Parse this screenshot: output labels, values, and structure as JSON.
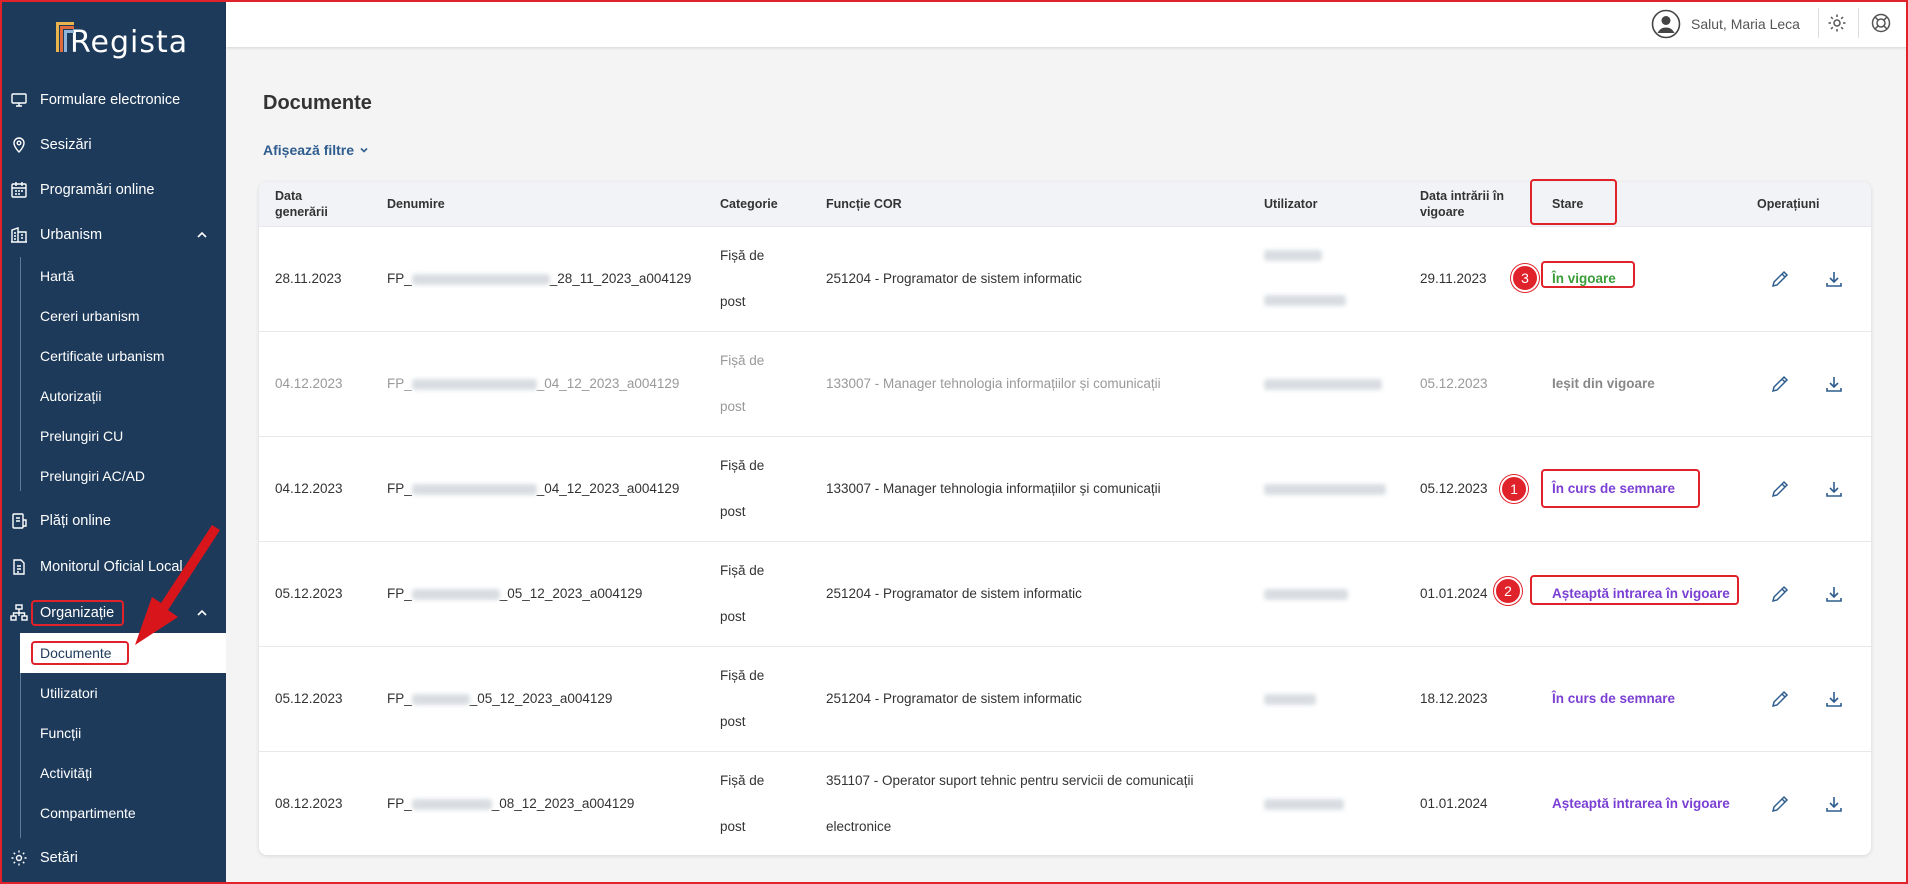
{
  "app": {
    "logo_text": "Regista"
  },
  "sidebar": {
    "items": [
      {
        "label": "Formulare electronice",
        "icon": "monitor-icon"
      },
      {
        "label": "Sesizări",
        "icon": "map-pin-icon"
      },
      {
        "label": "Programări online",
        "icon": "calendar-icon"
      },
      {
        "label": "Urbanism",
        "icon": "building-icon"
      },
      {
        "label": "Plăți online",
        "icon": "payment-icon"
      },
      {
        "label": "Monitorul Oficial Local",
        "icon": "gazette-icon"
      },
      {
        "label": "Organizație",
        "icon": "org-chart-icon"
      },
      {
        "label": "Setări",
        "icon": "gear-icon"
      }
    ],
    "urbanism_children": [
      "Hartă",
      "Cereri urbanism",
      "Certificate urbanism",
      "Autorizații",
      "Prelungiri CU",
      "Prelungiri AC/AD"
    ],
    "organizatie_children": [
      "Documente",
      "Utilizatori",
      "Funcții",
      "Activități",
      "Compartimente"
    ]
  },
  "topbar": {
    "greeting": "Salut, Maria Leca"
  },
  "page": {
    "title": "Documente",
    "filters_label": "Afișează filtre"
  },
  "table": {
    "headers": {
      "date_gen_1": "Data",
      "date_gen_2": "generării",
      "name": "Denumire",
      "category": "Categorie",
      "cor": "Funcție COR",
      "user": "Utilizator",
      "date_eff_1": "Data intrării în",
      "date_eff_2": "vigoare",
      "status": "Stare",
      "ops": "Operațiuni"
    },
    "rows": [
      {
        "date": "28.11.2023",
        "name_prefix": "FP_",
        "name_suffix": "_28_11_2023_a004129",
        "cat1": "Fișă de",
        "cat2": "post",
        "cor1": "251204 - Programator de sistem informatic",
        "cor2": "",
        "effective": "29.11.2023",
        "status": "În vigoare"
      },
      {
        "date": "04.12.2023",
        "name_prefix": "FP_",
        "name_suffix": "_04_12_2023_a004129",
        "cat1": "Fișă de",
        "cat2": "post",
        "cor1": "133007 - Manager tehnologia informațiilor și comunicații",
        "cor2": "",
        "effective": "05.12.2023",
        "status": "Ieșit din vigoare"
      },
      {
        "date": "04.12.2023",
        "name_prefix": "FP_",
        "name_suffix": "_04_12_2023_a004129",
        "cat1": "Fișă de",
        "cat2": "post",
        "cor1": "133007 - Manager tehnologia informațiilor și comunicații",
        "cor2": "",
        "effective": "05.12.2023",
        "status": "În curs de semnare"
      },
      {
        "date": "05.12.2023",
        "name_prefix": "FP_",
        "name_suffix": "_05_12_2023_a004129",
        "cat1": "Fișă de",
        "cat2": "post",
        "cor1": "251204 - Programator de sistem informatic",
        "cor2": "",
        "effective": "01.01.2024",
        "status": "Așteaptă intrarea în vigoare"
      },
      {
        "date": "05.12.2023",
        "name_prefix": "FP_",
        "name_suffix": "_05_12_2023_a004129",
        "cat1": "Fișă de",
        "cat2": "post",
        "cor1": "251204 - Programator de sistem informatic",
        "cor2": "",
        "effective": "18.12.2023",
        "status": "În curs de semnare"
      },
      {
        "date": "08.12.2023",
        "name_prefix": "FP_",
        "name_suffix": "_08_12_2023_a004129",
        "cat1": "Fișă de",
        "cat2": "post",
        "cor1": "351107 - Operator suport tehnic pentru servicii de comunicații",
        "cor2": "electronice",
        "effective": "01.01.2024",
        "status": "Așteaptă intrarea în vigoare"
      }
    ]
  },
  "annotations": {
    "badge1": "1",
    "badge2": "2",
    "badge3": "3"
  },
  "colors": {
    "sidebar": "#1d3a5a",
    "accent": "#2f5d8e",
    "annotation": "#e0222a",
    "status_green": "#3a9d3a",
    "status_purple": "#7b3fd3"
  }
}
